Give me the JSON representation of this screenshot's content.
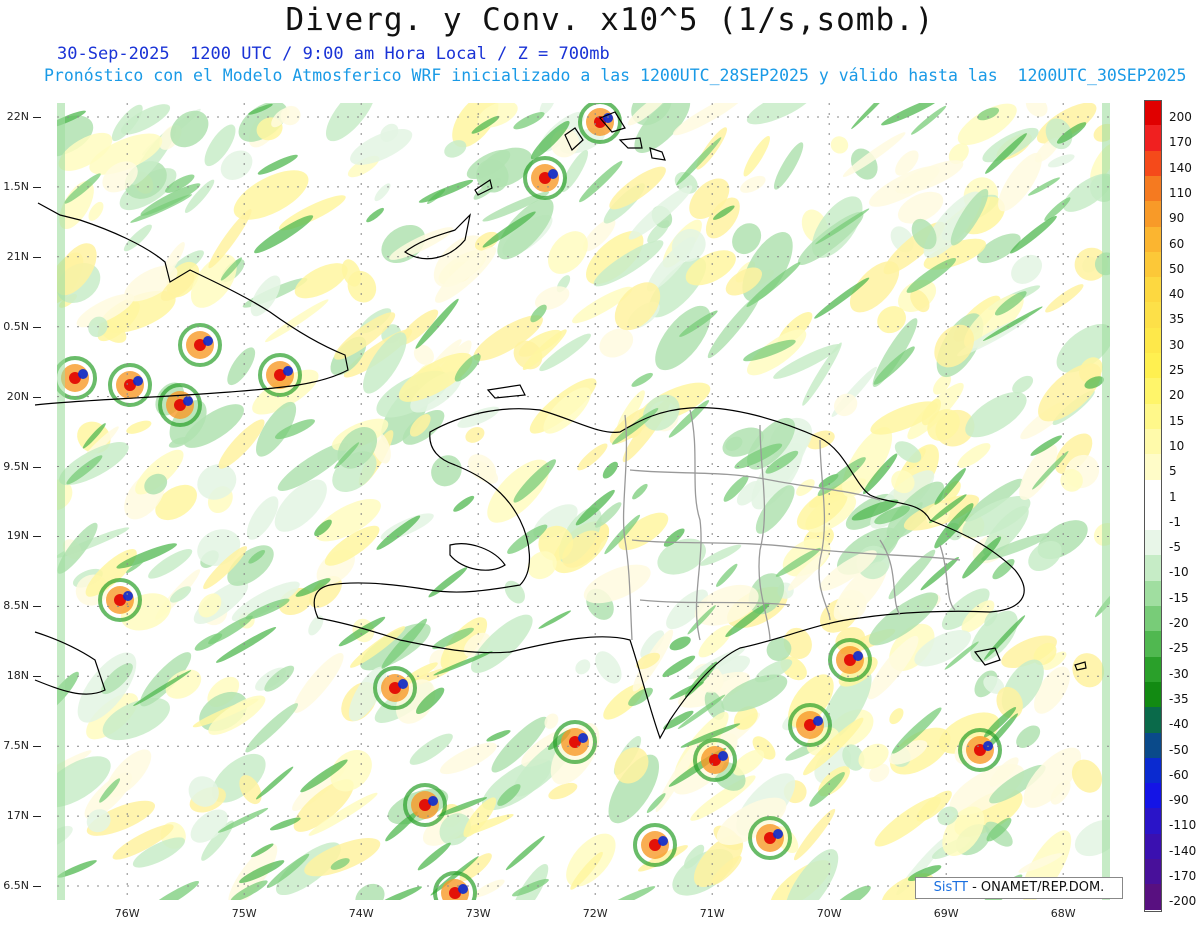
{
  "header": {
    "title": "Diverg. y Conv. x10^5 (1/s,somb.)",
    "subtitle1": "30-Sep-2025  1200 UTC / 9:00 am Hora Local / Z = 700mb",
    "subtitle2": "Pronóstico con el Modelo Atmosferico WRF inicializado a las 1200UTC_28SEP2025 y válido hasta las  1200UTC_30SEP2025"
  },
  "axes": {
    "lat_labels": [
      "22N",
      "1.5N",
      "21N",
      "0.5N",
      "20N",
      "9.5N",
      "19N",
      "8.5N",
      "18N",
      "7.5N",
      "17N",
      "6.5N"
    ],
    "lat_values": [
      22,
      21.5,
      21,
      20.5,
      20,
      19.5,
      19,
      18.5,
      18,
      17.5,
      17,
      16.5
    ],
    "lon_labels": [
      "76W",
      "75W",
      "74W",
      "73W",
      "72W",
      "71W",
      "70W",
      "69W",
      "68W"
    ],
    "lon_values": [
      -76,
      -75,
      -74,
      -73,
      -72,
      -71,
      -70,
      -69,
      -68
    ],
    "lat_range": [
      16.4,
      22.1
    ],
    "lon_range": [
      -76.6,
      -67.6
    ]
  },
  "colorbar": {
    "labels": [
      "200",
      "170",
      "140",
      "110",
      "90",
      "60",
      "50",
      "40",
      "35",
      "30",
      "25",
      "20",
      "15",
      "10",
      "5",
      "1",
      "-1",
      "-5",
      "-10",
      "-15",
      "-20",
      "-25",
      "-30",
      "-35",
      "-40",
      "-50",
      "-60",
      "-90",
      "-110",
      "-140",
      "-170",
      "-200"
    ],
    "colors": [
      "#e00000",
      "#f02020",
      "#f54a1a",
      "#f57a20",
      "#f89a28",
      "#fbb530",
      "#fcc838",
      "#fdd840",
      "#fde048",
      "#fee84a",
      "#fff050",
      "#fff56a",
      "#fff88a",
      "#fffaaa",
      "#fffcc8",
      "#ffffff",
      "#ffffff",
      "#e8f6e8",
      "#c6ecc6",
      "#a0dea0",
      "#78cc78",
      "#50b850",
      "#2aa02a",
      "#128a12",
      "#0a6a4a",
      "#0a4a8a",
      "#0a2ad0",
      "#1414e6",
      "#2a14c8",
      "#3a10b0",
      "#48109a",
      "#581080"
    ]
  },
  "credit": {
    "brand": "SisTT",
    "text": "- ONAMET/REP.DOM."
  }
}
